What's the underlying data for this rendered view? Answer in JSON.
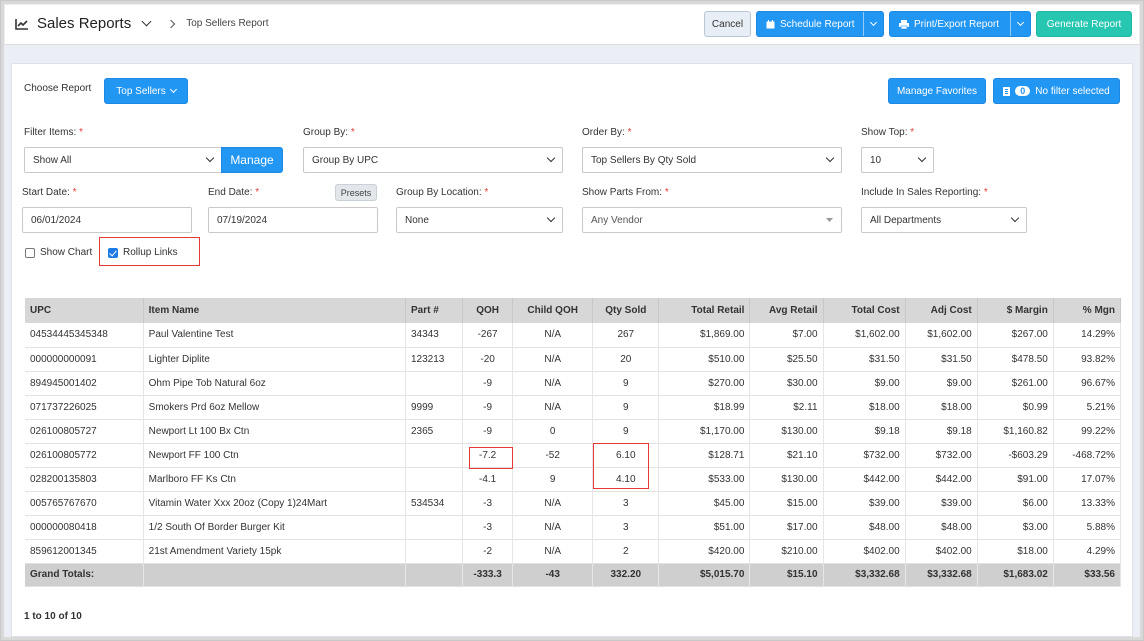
{
  "header": {
    "title": "Sales Reports",
    "breadcrumb": "Top Sellers Report",
    "cancel_label": "Cancel",
    "schedule_label": "Schedule Report",
    "print_label": "Print/Export Report",
    "generate_label": "Generate Report"
  },
  "report": {
    "choose_label": "Choose Report",
    "selected": "Top Sellers",
    "manage_favorites": "Manage Favorites",
    "filter_count": "0",
    "filter_status": "No filter selected"
  },
  "filters": {
    "filter_items_label": "Filter Items:",
    "filter_items_value": "Show All",
    "manage_label": "Manage",
    "group_by_label": "Group By:",
    "group_by_value": "Group By UPC",
    "order_by_label": "Order By:",
    "order_by_value": "Top Sellers By Qty Sold",
    "show_top_label": "Show Top:",
    "show_top_value": "10",
    "start_date_label": "Start Date:",
    "start_date_value": "06/01/2024",
    "end_date_label": "End Date:",
    "end_date_value": "07/19/2024",
    "presets_label": "Presets",
    "group_location_label": "Group By Location:",
    "group_location_value": "None",
    "parts_from_label": "Show Parts From:",
    "parts_from_value": "Any Vendor",
    "include_label": "Include In Sales Reporting:",
    "include_value": "All Departments",
    "required_mark": "*",
    "show_chart_label": "Show Chart",
    "rollup_label": "Rollup Links"
  },
  "table": {
    "columns": [
      "UPC",
      "Item Name",
      "Part #",
      "QOH",
      "Child QOH",
      "Qty Sold",
      "Total Retail",
      "Avg Retail",
      "Total Cost",
      "Adj Cost",
      "$ Margin",
      "% Mgn"
    ],
    "rows": [
      [
        "04534445345348",
        "Paul Valentine Test",
        "34343",
        "-267",
        "N/A",
        "267",
        "$1,869.00",
        "$7.00",
        "$1,602.00",
        "$1,602.00",
        "$267.00",
        "14.29%"
      ],
      [
        "000000000091",
        "Lighter Diplite",
        "123213",
        "-20",
        "N/A",
        "20",
        "$510.00",
        "$25.50",
        "$31.50",
        "$31.50",
        "$478.50",
        "93.82%"
      ],
      [
        "894945001402",
        "Ohm Pipe Tob Natural 6oz",
        "",
        "-9",
        "N/A",
        "9",
        "$270.00",
        "$30.00",
        "$9.00",
        "$9.00",
        "$261.00",
        "96.67%"
      ],
      [
        "071737226025",
        "Smokers Prd 6oz Mellow",
        "9999",
        "-9",
        "N/A",
        "9",
        "$18.99",
        "$2.11",
        "$18.00",
        "$18.00",
        "$0.99",
        "5.21%"
      ],
      [
        "026100805727",
        "Newport Lt 100 Bx Ctn",
        "2365",
        "-9",
        "0",
        "9",
        "$1,170.00",
        "$130.00",
        "$9.18",
        "$9.18",
        "$1,160.82",
        "99.22%"
      ],
      [
        "026100805772",
        "Newport FF 100 Ctn",
        "",
        "-7.2",
        "-52",
        "6.10",
        "$128.71",
        "$21.10",
        "$732.00",
        "$732.00",
        "-$603.29",
        "-468.72%"
      ],
      [
        "028200135803",
        "Marlboro FF Ks Ctn",
        "",
        "-4.1",
        "9",
        "4.10",
        "$533.00",
        "$130.00",
        "$442.00",
        "$442.00",
        "$91.00",
        "17.07%"
      ],
      [
        "005765767670",
        "Vitamin Water Xxx 20oz (Copy 1)24Mart",
        "534534",
        "-3",
        "N/A",
        "3",
        "$45.00",
        "$15.00",
        "$39.00",
        "$39.00",
        "$6.00",
        "13.33%"
      ],
      [
        "000000080418",
        "1/2 South Of Border Burger Kit",
        "",
        "-3",
        "N/A",
        "3",
        "$51.00",
        "$17.00",
        "$48.00",
        "$48.00",
        "$3.00",
        "5.88%"
      ],
      [
        "859612001345",
        "21st Amendment Variety 15pk",
        "",
        "-2",
        "N/A",
        "2",
        "$420.00",
        "$210.00",
        "$402.00",
        "$402.00",
        "$18.00",
        "4.29%"
      ]
    ],
    "totals": [
      "Grand Totals:",
      "",
      "",
      "-333.3",
      "-43",
      "332.20",
      "$5,015.70",
      "$15.10",
      "$3,332.68",
      "$3,332.68",
      "$1,683.02",
      "$33.56"
    ]
  },
  "pagination": "1 to 10 of 10",
  "colors": {
    "primary": "#2196f3",
    "accent_green": "#26c6b0",
    "highlight_red": "#e53935"
  }
}
